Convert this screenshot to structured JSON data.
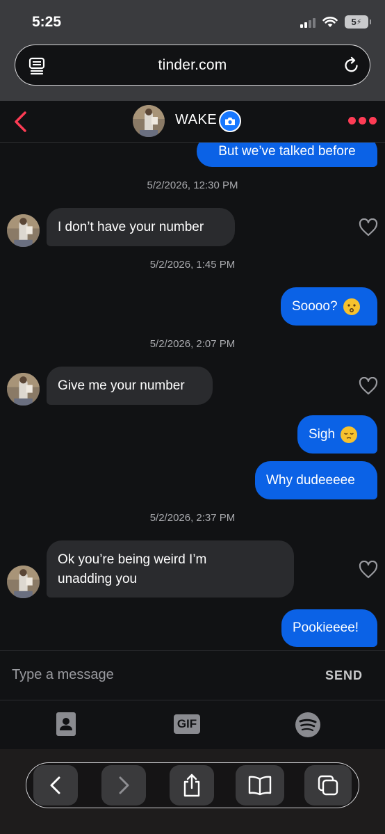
{
  "status_bar": {
    "time": "5:25",
    "battery": "5"
  },
  "browser": {
    "url": "tinder.com"
  },
  "chat_header": {
    "name": "WAKE"
  },
  "messages": [
    {
      "type": "outgoing",
      "text": "But we’ve talked before"
    },
    {
      "type": "timestamp",
      "text": "5/2/2026, 12:30 PM"
    },
    {
      "type": "incoming",
      "text": "I don’t have your number"
    },
    {
      "type": "timestamp",
      "text": "5/2/2026, 1:45 PM"
    },
    {
      "type": "outgoing",
      "text": "Soooo?",
      "emoji": "kissing-face"
    },
    {
      "type": "timestamp",
      "text": "5/2/2026, 2:07 PM"
    },
    {
      "type": "incoming",
      "text": "Give me your number"
    },
    {
      "type": "outgoing",
      "text": "Sigh",
      "emoji": "pensive-face"
    },
    {
      "type": "outgoing",
      "text": "Why dudeeeee"
    },
    {
      "type": "timestamp",
      "text": "5/2/2026, 2:37 PM"
    },
    {
      "type": "incoming",
      "text": "Ok you’re being weird I’m unadding you"
    },
    {
      "type": "outgoing",
      "text": "Pookieeee!"
    }
  ],
  "composer": {
    "placeholder": "Type a message",
    "send_label": "SEND"
  },
  "attachments": {
    "gif_label": "GIF"
  },
  "colors": {
    "outgoing_bubble": "#0b62e6",
    "incoming_bubble": "#2a2b2e",
    "accent": "#fe3c55",
    "background": "#111214"
  },
  "icons": [
    "back-chevron-icon",
    "camera-icon",
    "more-dots-icon",
    "heart-icon",
    "contact-card-icon",
    "gif-icon",
    "spotify-icon",
    "share-icon",
    "bookmarks-icon",
    "tabs-icon",
    "reload-icon",
    "reader-icon"
  ]
}
